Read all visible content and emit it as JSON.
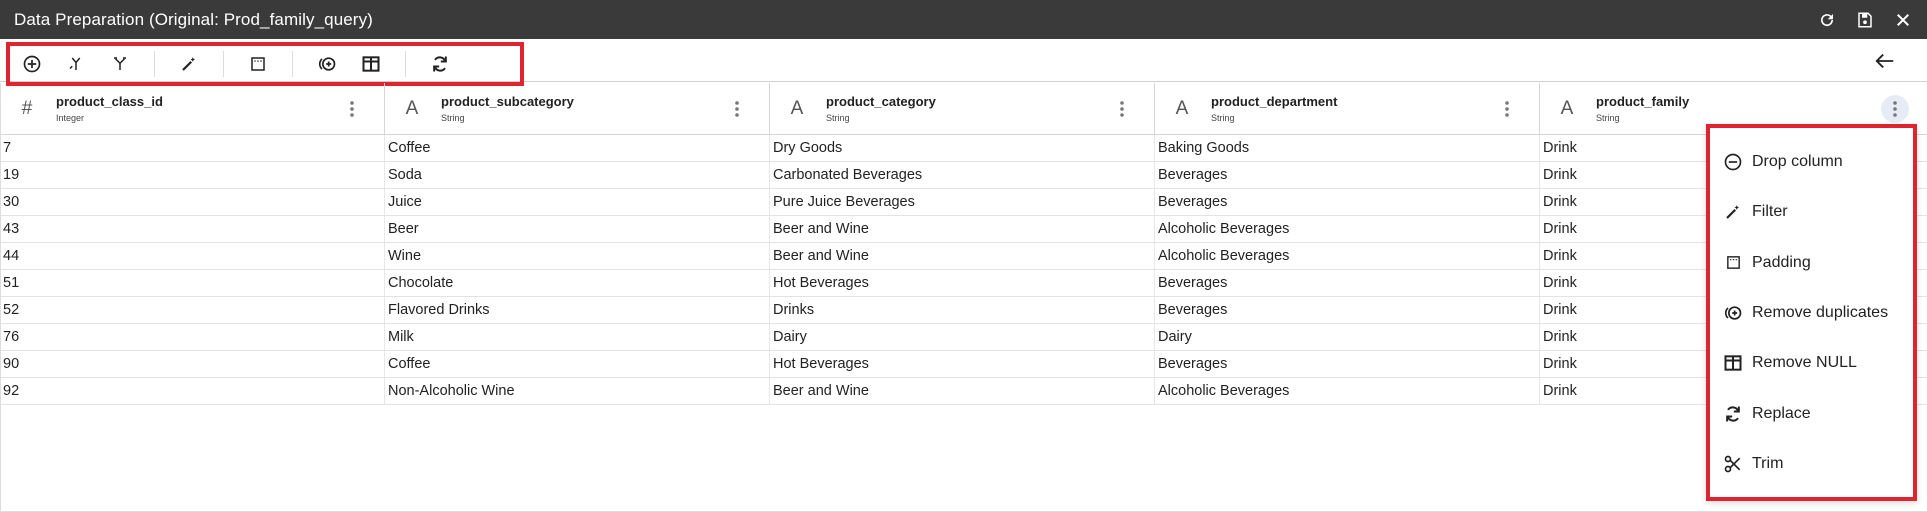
{
  "window": {
    "title": "Data Preparation (Original: Prod_family_query)",
    "actions": [
      {
        "icon": "refresh-icon"
      },
      {
        "icon": "save-icon"
      },
      {
        "icon": "close-icon"
      }
    ]
  },
  "toolbar": {
    "tools": [
      {
        "icon": "add-circle-icon"
      },
      {
        "icon": "merge-icon"
      },
      {
        "icon": "split-icon"
      },
      {
        "icon": "filter-wand-icon"
      },
      {
        "icon": "padding-icon"
      },
      {
        "icon": "remove-duplicates-icon"
      },
      {
        "icon": "remove-null-icon"
      },
      {
        "icon": "replace-icon"
      }
    ],
    "back_icon": "arrow-left-icon"
  },
  "columns": [
    {
      "name": "product_class_id",
      "type": "Integer",
      "type_glyph": "#"
    },
    {
      "name": "product_subcategory",
      "type": "String",
      "type_glyph": "A"
    },
    {
      "name": "product_category",
      "type": "String",
      "type_glyph": "A"
    },
    {
      "name": "product_department",
      "type": "String",
      "type_glyph": "A"
    },
    {
      "name": "product_family",
      "type": "String",
      "type_glyph": "A"
    }
  ],
  "rows": [
    [
      "7",
      "Coffee",
      "Dry Goods",
      "Baking Goods",
      "Drink"
    ],
    [
      "19",
      "Soda",
      "Carbonated Beverages",
      "Beverages",
      "Drink"
    ],
    [
      "30",
      "Juice",
      "Pure Juice Beverages",
      "Beverages",
      "Drink"
    ],
    [
      "43",
      "Beer",
      "Beer and Wine",
      "Alcoholic Beverages",
      "Drink"
    ],
    [
      "44",
      "Wine",
      "Beer and Wine",
      "Alcoholic Beverages",
      "Drink"
    ],
    [
      "51",
      "Chocolate",
      "Hot Beverages",
      "Beverages",
      "Drink"
    ],
    [
      "52",
      "Flavored Drinks",
      "Drinks",
      "Beverages",
      "Drink"
    ],
    [
      "76",
      "Milk",
      "Dairy",
      "Dairy",
      "Drink"
    ],
    [
      "90",
      "Coffee",
      "Hot Beverages",
      "Beverages",
      "Drink"
    ],
    [
      "92",
      "Non-Alcoholic Wine",
      "Beer and Wine",
      "Alcoholic Beverages",
      "Drink"
    ]
  ],
  "column_menu": {
    "items": [
      {
        "label": "Drop column",
        "icon": "minus-circle-icon"
      },
      {
        "label": "Filter",
        "icon": "filter-wand-icon"
      },
      {
        "label": "Padding",
        "icon": "padding-icon"
      },
      {
        "label": "Remove duplicates",
        "icon": "remove-duplicates-icon"
      },
      {
        "label": "Remove NULL",
        "icon": "remove-null-icon"
      },
      {
        "label": "Replace",
        "icon": "replace-icon"
      },
      {
        "label": "Trim",
        "icon": "scissors-icon"
      }
    ]
  },
  "colors": {
    "titlebar": "#3a3a3a",
    "highlight_border": "#e0242f"
  }
}
